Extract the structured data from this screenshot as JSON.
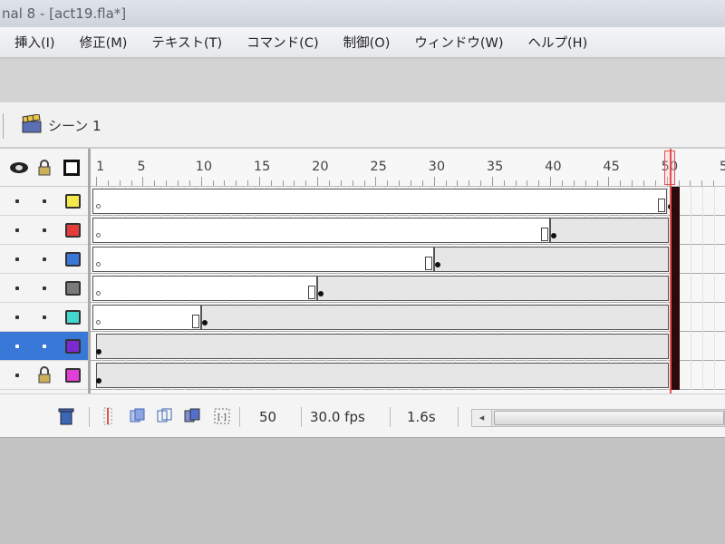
{
  "window": {
    "title": "nal 8 - [act19.fla*]"
  },
  "menu": [
    {
      "label": "挿入(I)"
    },
    {
      "label": "修正(M)"
    },
    {
      "label": "テキスト(T)"
    },
    {
      "label": "コマンド(C)"
    },
    {
      "label": "制御(O)"
    },
    {
      "label": "ウィンドウ(W)"
    },
    {
      "label": "ヘルプ(H)"
    }
  ],
  "scene": {
    "label": "シーン 1"
  },
  "ruler": [
    "1",
    "5",
    "10",
    "15",
    "20",
    "25",
    "30",
    "35",
    "40",
    "45",
    "50",
    "5"
  ],
  "layers": [
    {
      "color": "#f5e84a",
      "selected": false,
      "locked": false
    },
    {
      "color": "#e53b3b",
      "selected": false,
      "locked": false
    },
    {
      "color": "#3a78d8",
      "selected": false,
      "locked": false
    },
    {
      "color": "#7a7a7a",
      "selected": false,
      "locked": false
    },
    {
      "color": "#44d7d0",
      "selected": false,
      "locked": false
    },
    {
      "color": "#7b2ad1",
      "selected": true,
      "locked": false
    },
    {
      "color": "#e23ed8",
      "selected": false,
      "locked": true
    }
  ],
  "tracks": [
    {
      "tween_start_frame": 50
    },
    {
      "tween_start_frame": 40
    },
    {
      "tween_start_frame": 30
    },
    {
      "tween_start_frame": 20
    },
    {
      "tween_start_frame": 10
    },
    {
      "tween_start_frame": 1
    },
    {
      "tween_start_frame": 1
    }
  ],
  "playhead": {
    "frame": 50
  },
  "status": {
    "current_frame": "50",
    "frame_rate": "30.0 fps",
    "elapsed_time": "1.6s"
  },
  "accent_color": "#e25050"
}
